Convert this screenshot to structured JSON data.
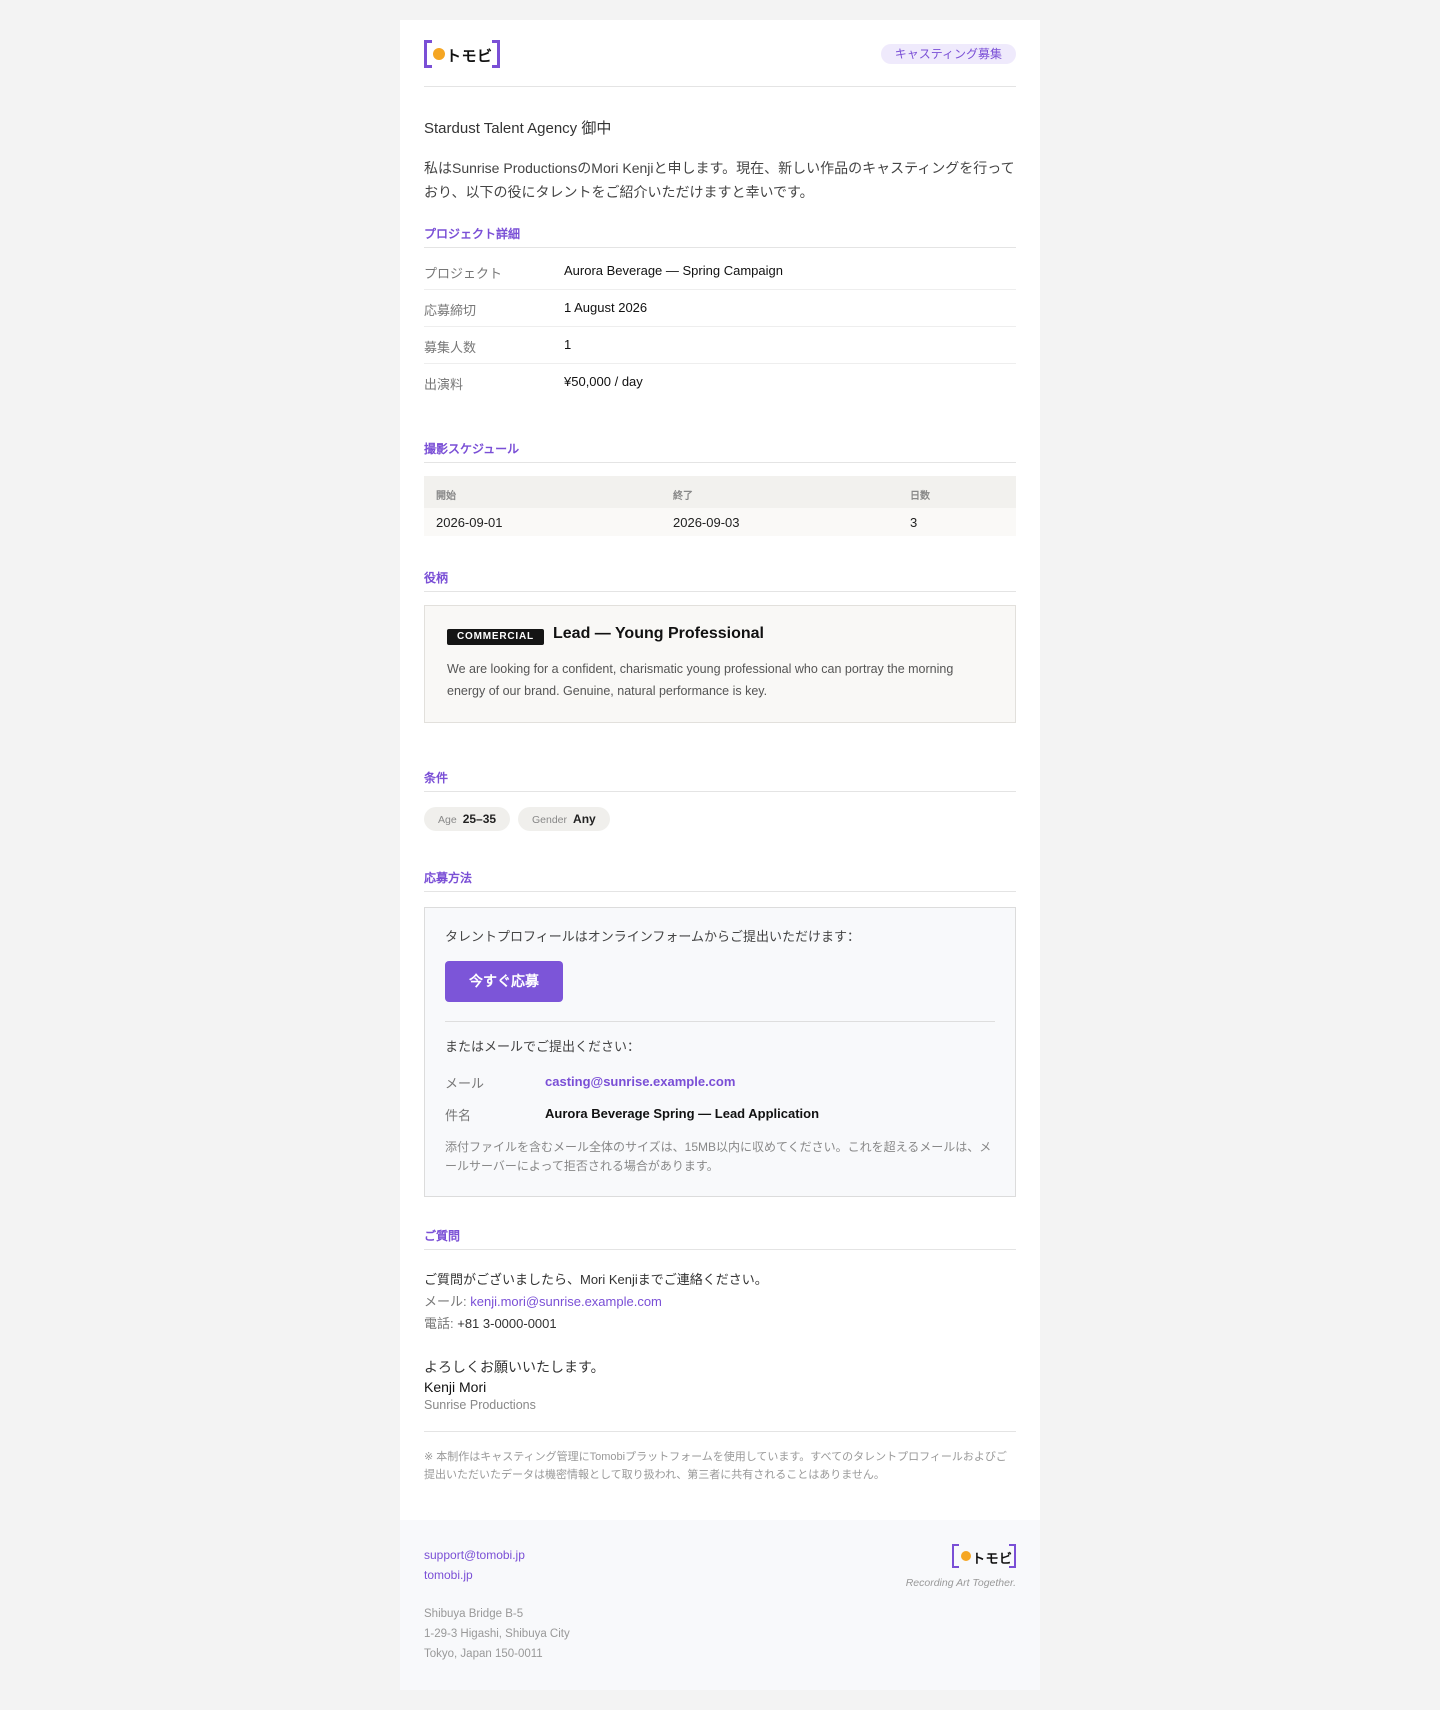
{
  "header": {
    "logo_text": "トモビ",
    "badge": "キャスティング募集"
  },
  "greeting": "Stardust Talent Agency 御中",
  "intro": "私はSunrise ProductionsのMori Kenjiと申します。現在、新しい作品のキャスティングを行っており、以下の役にタレントをご紹介いただけますと幸いです。",
  "project": {
    "section_title": "プロジェクト詳細",
    "rows": [
      {
        "label": "プロジェクト",
        "value": "Aurora Beverage — Spring Campaign"
      },
      {
        "label": "応募締切",
        "value": "1 August 2026"
      },
      {
        "label": "募集人数",
        "value": "1"
      },
      {
        "label": "出演料",
        "value": "¥50,000 / day"
      }
    ]
  },
  "schedule": {
    "section_title": "撮影スケジュール",
    "headers": [
      "開始",
      "終了",
      "日数"
    ],
    "rows": [
      [
        "2026-09-01",
        "2026-09-03",
        "3"
      ]
    ]
  },
  "role": {
    "section_title": "役柄",
    "tag": "COMMERCIAL",
    "title": "Lead — Young Professional",
    "description": "We are looking for a confident, charismatic young professional who can portray the morning energy of our brand. Genuine, natural performance is key."
  },
  "conditions": {
    "section_title": "条件",
    "chips": [
      {
        "label": "Age",
        "value": "25–35"
      },
      {
        "label": "Gender",
        "value": "Any"
      }
    ]
  },
  "apply": {
    "section_title": "応募方法",
    "online_text": "タレントプロフィールはオンラインフォームからご提出いただけます：",
    "button_label": "今すぐ応募",
    "email_intro": "またはメールでご提出ください：",
    "email_label": "メール",
    "email_value": "casting@sunrise.example.com",
    "subject_label": "件名",
    "subject_value": "Aurora Beverage Spring — Lead Application",
    "note": "添付ファイルを含むメール全体のサイズは、15MB以内に収めてください。これを超えるメールは、メールサーバーによって拒否される場合があります。"
  },
  "questions": {
    "section_title": "ご質問",
    "text": "ご質問がございましたら、Mori Kenjiまでご連絡ください。",
    "email_label": "メール: ",
    "email_value": "kenji.mori@sunrise.example.com",
    "phone_label": "電話: ",
    "phone_value": "+81 3-0000-0001"
  },
  "signoff": {
    "closing": "よろしくお願いいたします。",
    "name": "Kenji Mori",
    "company": "Sunrise Productions"
  },
  "disclaimer": "※ 本制作はキャスティング管理にTomobiプラットフォームを使用しています。すべてのタレントプロフィールおよびご提出いただいたデータは機密情報として取り扱われ、第三者に共有されることはありません。",
  "footer": {
    "support_email": "support@tomobi.jp",
    "website": "tomobi.jp",
    "address_lines": [
      "Shibuya Bridge B-5",
      "1-29-3 Higashi, Shibuya City",
      "Tokyo, Japan 150-0011"
    ],
    "logo_text": "トモビ",
    "tagline": "Recording Art Together."
  },
  "colors": {
    "accent": "#7a4fd6",
    "logo_dot": "#f5a623",
    "button": "#7c55d8",
    "page_bg": "#f3f3f3"
  }
}
